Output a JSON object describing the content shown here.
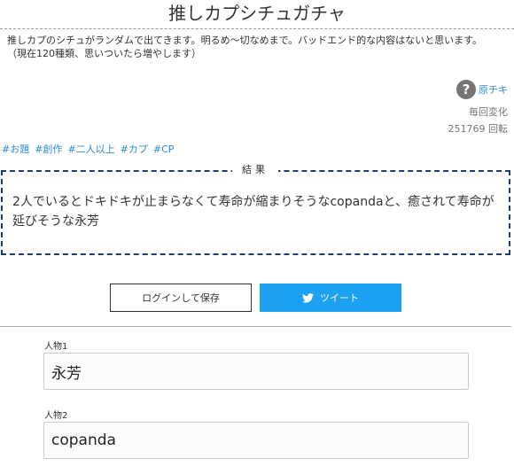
{
  "header": {
    "title": "推しカプシチュガチャ",
    "description_line1": "推しカプのシチュがランダムで出てきます。明るめ〜切なめまで。バッドエンド的な内容はないと思います。",
    "description_line2": "（現在120種類、思いついたら増やします）"
  },
  "author": {
    "icon": "question-mark-icon",
    "name": "原チキ"
  },
  "meta": {
    "change": "毎回変化",
    "spins": "251769 回転"
  },
  "tags": [
    "#お題",
    "#創作",
    "#二人以上",
    "#カプ",
    "#CP"
  ],
  "result": {
    "label": "結果",
    "text": "2人でいるとドキドキが止まらなくて寿命が縮まりそうなcopandaと、癒されて寿命が延びそうな永芳"
  },
  "buttons": {
    "login_save": "ログインして保存",
    "tweet": "ツイート",
    "tweet_icon": "twitter-bird-icon"
  },
  "fields": [
    {
      "label": "人物1",
      "value": "永芳"
    },
    {
      "label": "人物2",
      "value": "copanda"
    }
  ],
  "colors": {
    "link": "#2a8bd6",
    "tweet_button": "#1da1f2",
    "result_border": "#1f3c6e",
    "author_icon": "#757575"
  }
}
